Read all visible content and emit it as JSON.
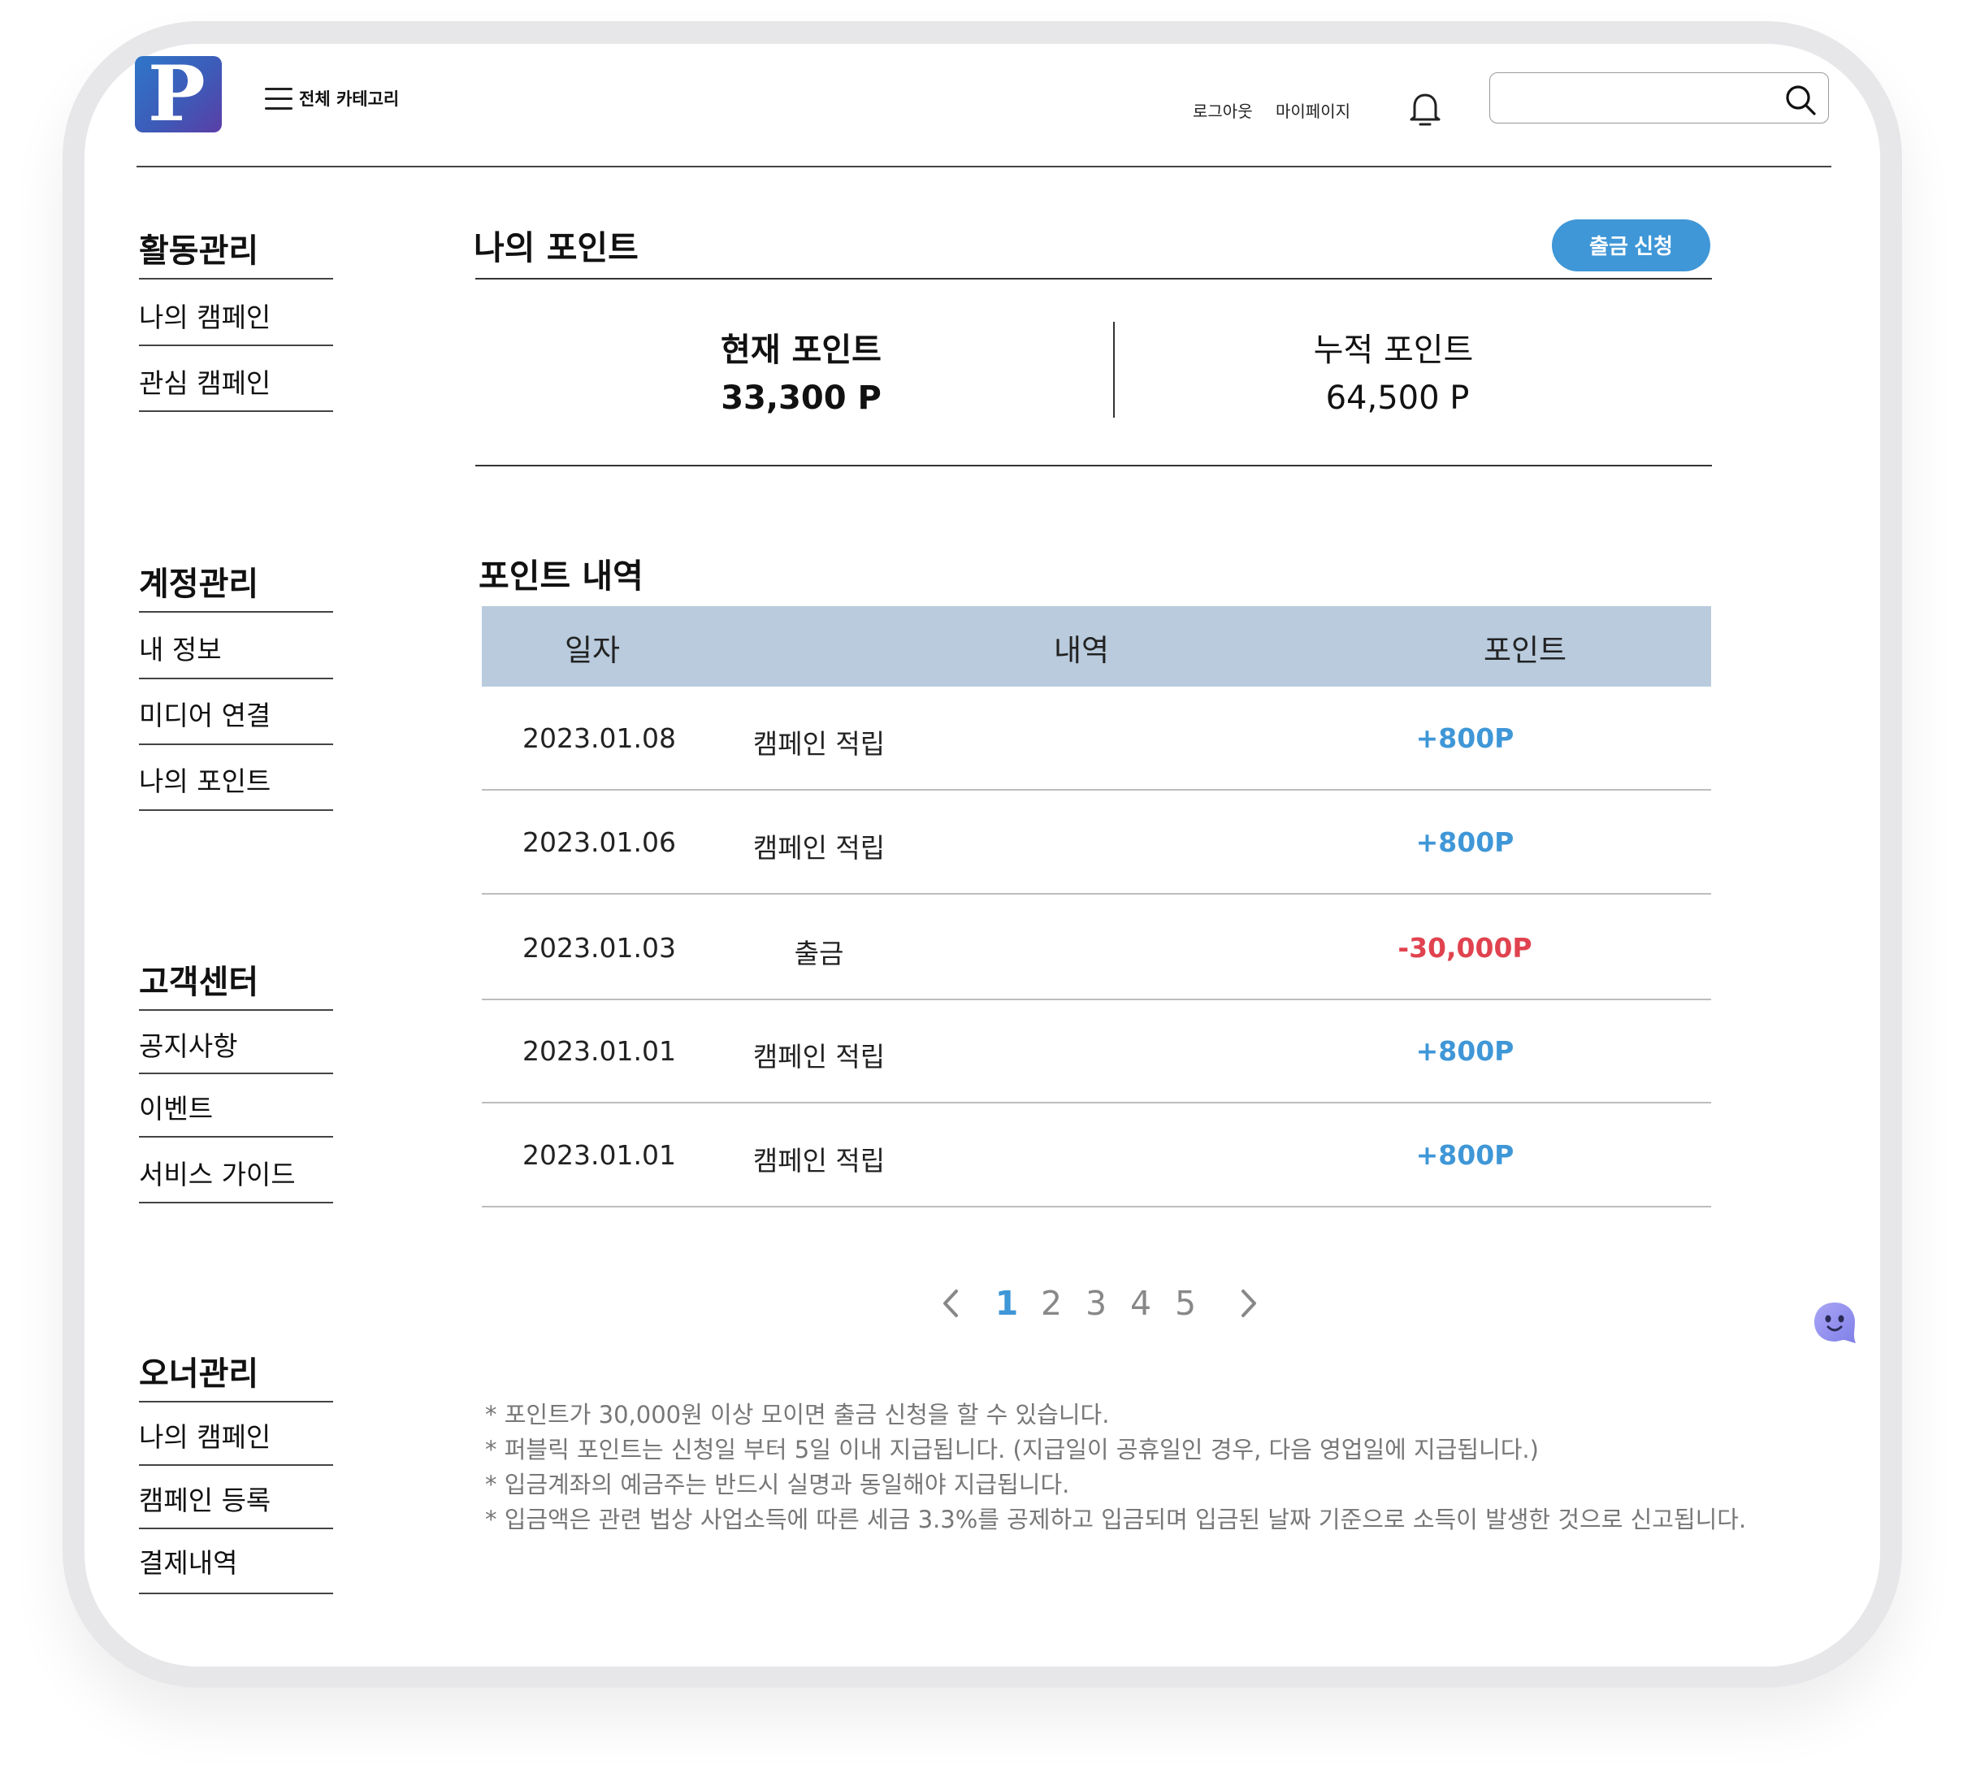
{
  "header": {
    "logo_letter": "P",
    "category_label": "전체 카테고리",
    "logout": "로그아웃",
    "mypage": "마이페이지",
    "search_placeholder": ""
  },
  "sidebar": {
    "sections": [
      {
        "title": "활동관리",
        "items": [
          "나의 캠페인",
          "관심 캠페인"
        ]
      },
      {
        "title": "계정관리",
        "items": [
          "내 정보",
          "미디어 연결",
          "나의 포인트"
        ]
      },
      {
        "title": "고객센터",
        "items": [
          "공지사항",
          "이벤트",
          "서비스 가이드"
        ]
      },
      {
        "title": "오너관리",
        "items": [
          "나의 캠페인",
          "캠페인 등록",
          "결제내역"
        ]
      }
    ]
  },
  "main": {
    "title": "나의 포인트",
    "withdraw_button": "출금 신청",
    "current_label": "현재 포인트",
    "current_value": "33,300 P",
    "total_label": "누적 포인트",
    "total_value": "64,500 P",
    "history_title": "포인트 내역",
    "columns": [
      "일자",
      "내역",
      "포인트"
    ],
    "rows": [
      {
        "date": "2023.01.08",
        "desc": "캠페인  적립",
        "points": "+800P",
        "color": "#3f97d7"
      },
      {
        "date": "2023.01.06",
        "desc": "캠페인  적립",
        "points": "+800P",
        "color": "#3f97d7"
      },
      {
        "date": "2023.01.03",
        "desc": "출금",
        "points": "-30,000P",
        "color": "#e0434f"
      },
      {
        "date": "2023.01.01",
        "desc": "캠페인  적립",
        "points": "+800P",
        "color": "#3f97d7"
      },
      {
        "date": "2023.01.01",
        "desc": "캠페인  적립",
        "points": "+800P",
        "color": "#3f97d7"
      }
    ],
    "pagination": {
      "pages": [
        "1",
        "2",
        "3",
        "4",
        "5"
      ],
      "current": "1"
    },
    "notes": [
      "* 포인트가 30,000원 이상 모이면 출금 신청을 할 수 있습니다.",
      "* 퍼블릭 포인트는 신청일 부터 5일 이내 지급됩니다. (지급일이 공휴일인 경우, 다음 영업일에 지급됩니다.)",
      "* 입금계좌의 예금주는 반드시 실명과 동일해야 지급됩니다.",
      "* 입금액은 관련 법상 사업소득에 따른 세금 3.3%를 공제하고 입금되며 입금된 날짜 기준으로 소득이 발생한 것으로 신고됩니다."
    ]
  },
  "colors": {
    "accent": "#3f97d7",
    "negative": "#e0434f",
    "table_header": "#b9cbdd"
  }
}
